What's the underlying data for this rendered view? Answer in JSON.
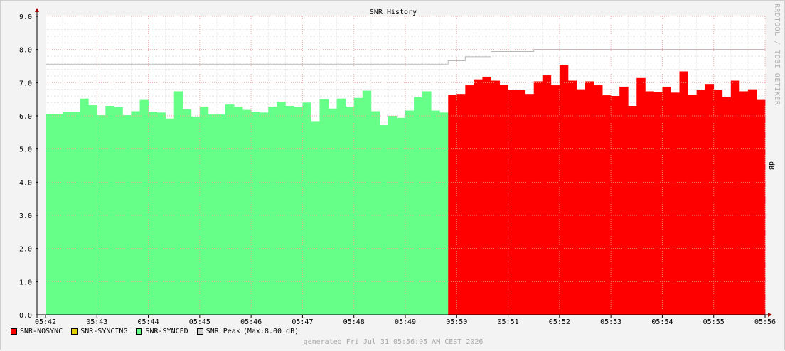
{
  "colors": {
    "nosync": "#ff0000",
    "syncing": "#e6cf00",
    "synced": "#66ff88",
    "peak": "#cccccc",
    "grid_major": "#f19c9c",
    "grid_minor": "#e6e6e6",
    "axis": "#000000",
    "arrow": "#a00000"
  },
  "legend": {
    "items": [
      {
        "label": "SNR-NOSYNC",
        "color": "#ff0000"
      },
      {
        "label": "SNR-SYNCING",
        "color": "#e6cf00"
      },
      {
        "label": "SNR-SYNCED",
        "color": "#66ff88"
      },
      {
        "label": "SNR Peak",
        "color": "#cccccc"
      }
    ],
    "max_text": "(Max:8.00 dB)"
  },
  "footer": "generated Fri Jul 31 05:56:05 AM CEST 2026",
  "side_text": "RRDTOOL / TOBI OETIKER",
  "chart_data": {
    "type": "area",
    "title": "SNR History",
    "ylabel": "dB",
    "xlabel": "",
    "ylim": [
      0,
      9
    ],
    "yticks": [
      "0.0",
      "1.0",
      "2.0",
      "3.0",
      "4.0",
      "5.0",
      "6.0",
      "7.0",
      "8.0",
      "9.0"
    ],
    "xticks": [
      "05:42",
      "05:43",
      "05:44",
      "05:45",
      "05:46",
      "05:47",
      "05:48",
      "05:49",
      "05:50",
      "05:51",
      "05:52",
      "05:53",
      "05:54",
      "05:55",
      "05:56"
    ],
    "grid": true,
    "legend_position": "bottom-left",
    "series": [
      {
        "name": "SNR-SYNCED",
        "color": "#66ff88",
        "start": "05:42",
        "step_seconds": 10,
        "values": [
          6.05,
          6.05,
          6.12,
          6.12,
          6.52,
          6.32,
          6.02,
          6.3,
          6.26,
          6.02,
          6.14,
          6.48,
          6.12,
          6.1,
          5.92,
          6.74,
          6.2,
          5.98,
          6.28,
          6.04,
          6.04,
          6.34,
          6.28,
          6.18,
          6.12,
          6.1,
          6.28,
          6.42,
          6.3,
          6.26,
          6.4,
          5.82,
          6.5,
          6.22,
          6.52,
          6.28,
          6.54,
          6.76,
          6.14,
          5.72,
          6.0,
          5.94,
          6.16,
          6.56,
          6.74,
          6.16,
          6.1
        ]
      },
      {
        "name": "SNR-NOSYNC",
        "color": "#ff0000",
        "start": "05:49:50",
        "step_seconds": 10,
        "values": [
          6.64,
          6.66,
          6.92,
          7.1,
          7.18,
          7.06,
          6.94,
          6.78,
          6.78,
          6.66,
          7.04,
          7.22,
          6.92,
          7.54,
          7.06,
          6.8,
          7.04,
          6.92,
          6.62,
          6.6,
          6.88,
          6.3,
          7.14,
          6.74,
          6.72,
          6.88,
          6.7,
          7.34,
          6.64,
          6.78,
          6.96,
          6.78,
          6.56,
          7.06,
          6.74,
          6.8,
          6.48
        ]
      },
      {
        "name": "SNR Peak",
        "color": "#cccccc",
        "start": "05:42",
        "type": "step-line",
        "points": [
          [
            0,
            7.56
          ],
          [
            47,
            7.56
          ],
          [
            47,
            7.66
          ],
          [
            49,
            7.66
          ],
          [
            49,
            7.78
          ],
          [
            52,
            7.78
          ],
          [
            52,
            7.94
          ],
          [
            57,
            7.94
          ],
          [
            57,
            8.0
          ],
          [
            84,
            8.0
          ]
        ]
      }
    ]
  }
}
